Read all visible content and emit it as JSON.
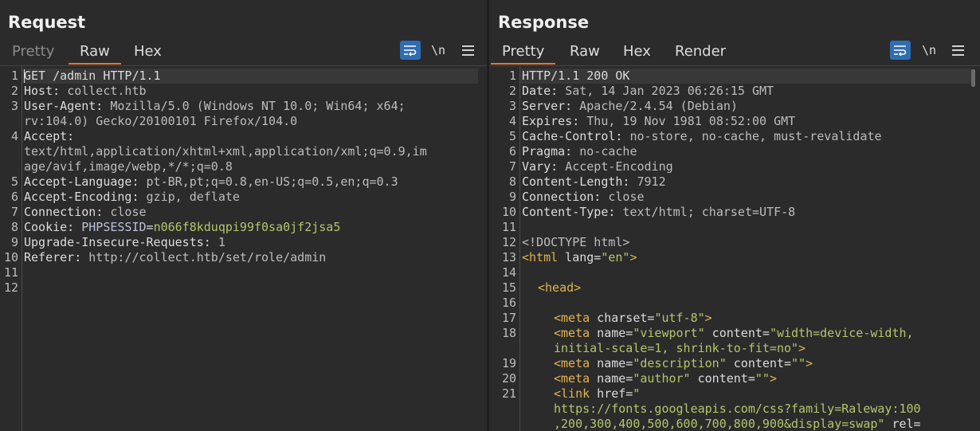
{
  "request": {
    "title": "Request",
    "tabs": [
      {
        "label": "Pretty",
        "state": "disabled"
      },
      {
        "label": "Raw",
        "state": "active"
      },
      {
        "label": "Hex",
        "state": "normal"
      }
    ],
    "newline_toggle": "\\n",
    "line_numbers": [
      "1",
      "2",
      "3",
      "",
      "4",
      "",
      "",
      "5",
      "6",
      "7",
      "8",
      "9",
      "10",
      "11",
      "12"
    ],
    "lines": [
      {
        "k": "GET /admin HTTP/1.1",
        "v": ""
      },
      {
        "k": "Host: ",
        "v": "collect.htb"
      },
      {
        "k": "User-Agent: ",
        "v": "Mozilla/5.0 (Windows NT 10.0; Win64; x64;"
      },
      {
        "k": "",
        "v": "rv:104.0) Gecko/20100101 Firefox/104.0"
      },
      {
        "k": "Accept:",
        "v": ""
      },
      {
        "k": "",
        "v": "text/html,application/xhtml+xml,application/xml;q=0.9,im"
      },
      {
        "k": "",
        "v": "age/avif,image/webp,*/*;q=0.8"
      },
      {
        "k": "Accept-Language: ",
        "v": "pt-BR,pt;q=0.8,en-US;q=0.5,en;q=0.3"
      },
      {
        "k": "Accept-Encoding: ",
        "v": "gzip, deflate"
      },
      {
        "k": "Connection: ",
        "v": "close"
      },
      {
        "k": "Cookie: ",
        "v": ""
      },
      {
        "k": "Upgrade-Insecure-Requests: ",
        "v": "1"
      },
      {
        "k": "Referer: ",
        "v": "http://collect.htb/set/role/admin"
      }
    ],
    "cookie": {
      "name": "PHPSESSID",
      "eq": "=",
      "value": "n066f8kduqpi99f0sa0jf2jsa5"
    }
  },
  "response": {
    "title": "Response",
    "tabs": [
      {
        "label": "Pretty",
        "state": "active"
      },
      {
        "label": "Raw",
        "state": "normal"
      },
      {
        "label": "Hex",
        "state": "normal"
      },
      {
        "label": "Render",
        "state": "normal"
      }
    ],
    "newline_toggle": "\\n",
    "line_numbers": [
      "1",
      "2",
      "3",
      "4",
      "5",
      "6",
      "7",
      "8",
      "9",
      "10",
      "11",
      "12",
      "13",
      "14",
      "15",
      "16",
      "17",
      "18",
      "",
      "19",
      "20",
      "21",
      "",
      ""
    ],
    "headers": [
      {
        "k": "HTTP/1.1 200 OK",
        "v": ""
      },
      {
        "k": "Date: ",
        "v": "Sat, 14 Jan 2023 06:26:15 GMT"
      },
      {
        "k": "Server: ",
        "v": "Apache/2.4.54 (Debian)"
      },
      {
        "k": "Expires: ",
        "v": "Thu, 19 Nov 1981 08:52:00 GMT"
      },
      {
        "k": "Cache-Control: ",
        "v": "no-store, no-cache, must-revalidate"
      },
      {
        "k": "Pragma: ",
        "v": "no-cache"
      },
      {
        "k": "Vary: ",
        "v": "Accept-Encoding"
      },
      {
        "k": "Content-Length: ",
        "v": "7912"
      },
      {
        "k": "Connection: ",
        "v": "close"
      },
      {
        "k": "Content-Type: ",
        "v": "text/html; charset=UTF-8"
      }
    ],
    "html": {
      "doctype": "<!DOCTYPE html>",
      "html_open": "<html",
      "lang_attr": " lang=",
      "lang_val": "\"en\"",
      "close": ">",
      "head": "<head>",
      "meta_open": "<meta",
      "charset_attr": " charset=",
      "charset_val": "\"utf-8\"",
      "name_attr": " name=",
      "content_attr": " content=",
      "viewport_name": "\"viewport\"",
      "viewport_val1": "\"width=device-width,",
      "viewport_val2": "initial-scale=1, shrink-to-fit=no\"",
      "description_name": "\"description\"",
      "author_name": "\"author\"",
      "empty_val": "\"\"",
      "link_open": "<link",
      "href_attr": " href=",
      "href_q": "\"",
      "href_l1": "https://fonts.googleapis.com/css?family=Raleway:100",
      "href_l2": ",200,300,400,500,600,700,800,900&display=swap\"",
      "rel_attr": " rel="
    }
  },
  "colors": {
    "background": "#2b2b2b",
    "accent_tab": "#e8733a",
    "button_blue": "#2f6db2",
    "value_green": "#b3c66b",
    "tag_orange": "#e3b34f"
  }
}
